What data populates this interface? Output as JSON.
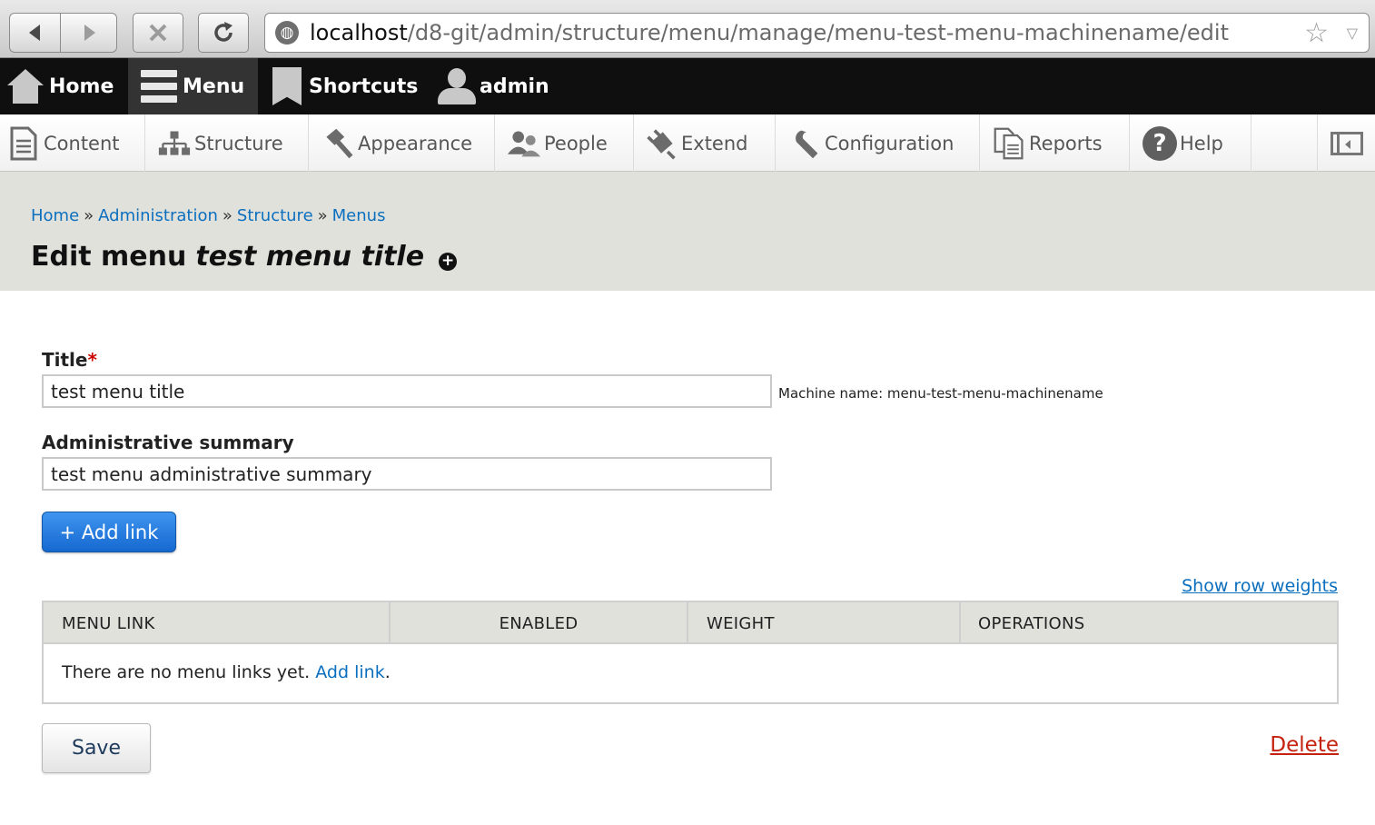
{
  "browser": {
    "url_host": "localhost",
    "url_path": "/d8-git/admin/structure/menu/manage/menu-test-menu-machinename/edit"
  },
  "toolbar": {
    "home": "Home",
    "menu": "Menu",
    "shortcuts": "Shortcuts",
    "user": "admin"
  },
  "admin_menu": {
    "items": [
      {
        "label": "Content",
        "icon": "content-icon"
      },
      {
        "label": "Structure",
        "icon": "structure-icon"
      },
      {
        "label": "Appearance",
        "icon": "appearance-icon"
      },
      {
        "label": "People",
        "icon": "people-icon"
      },
      {
        "label": "Extend",
        "icon": "extend-icon"
      },
      {
        "label": "Configuration",
        "icon": "configuration-icon"
      },
      {
        "label": "Reports",
        "icon": "reports-icon"
      },
      {
        "label": "Help",
        "icon": "help-icon"
      }
    ]
  },
  "breadcrumb": {
    "items": [
      "Home",
      "Administration",
      "Structure",
      "Menus"
    ],
    "separator": "»"
  },
  "page": {
    "title_prefix": "Edit menu",
    "title_name": "test menu title",
    "shortcut_add": "+"
  },
  "form": {
    "title_label": "Title",
    "required_marker": "*",
    "title_value": "test menu title",
    "machine_name": "Machine name: menu-test-menu-machinename",
    "summary_label": "Administrative summary",
    "summary_value": "test menu administrative summary",
    "add_link_button": "+ Add link",
    "show_row_weights": "Show row weights"
  },
  "table": {
    "headers": [
      "MENU LINK",
      "ENABLED",
      "WEIGHT",
      "OPERATIONS"
    ],
    "empty_text": "There are no menu links yet.",
    "empty_link": "Add link",
    "empty_suffix": "."
  },
  "actions": {
    "save": "Save",
    "delete": "Delete"
  },
  "colors": {
    "link": "#0b6fbf",
    "delete": "#c4210f",
    "primary_button": "#1668cf",
    "toolbar_bg": "#0f0f0f",
    "header_bg": "#e1e1dc"
  }
}
